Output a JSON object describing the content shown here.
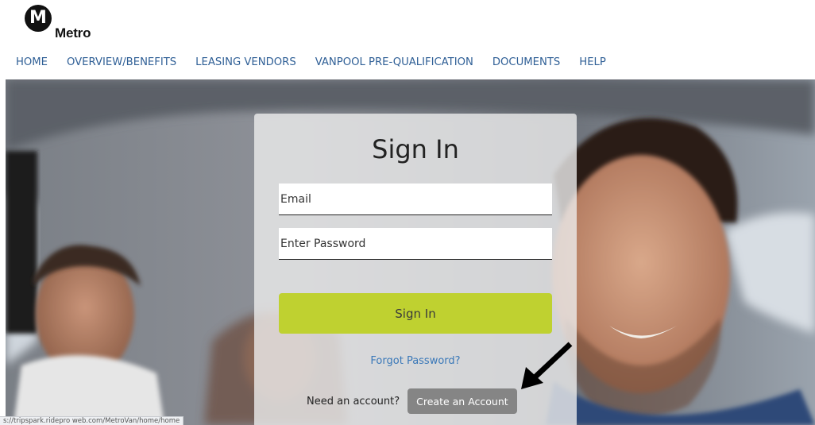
{
  "brand": {
    "logo_letter": "M",
    "logo_word": "Metro"
  },
  "nav": {
    "items": [
      "HOME",
      "OVERVIEW/BENEFITS",
      "LEASING VENDORS",
      "VANPOOL PRE-QUALIFICATION",
      "DOCUMENTS",
      "HELP"
    ]
  },
  "signin": {
    "title": "Sign In",
    "email_placeholder": "Email",
    "password_placeholder": "Enter Password",
    "button_label": "Sign In",
    "forgot_label": "Forgot Password?",
    "need_account_text": "Need an account?",
    "create_account_label": "Create an Account"
  },
  "status_bar": {
    "url": "s://tripspark.ridepro web.com/MetroVan/home/home"
  },
  "colors": {
    "nav_link": "#2f5f96",
    "signin_button": "#bfd130",
    "create_button": "#858585",
    "forgot_link": "#3a78b8"
  }
}
